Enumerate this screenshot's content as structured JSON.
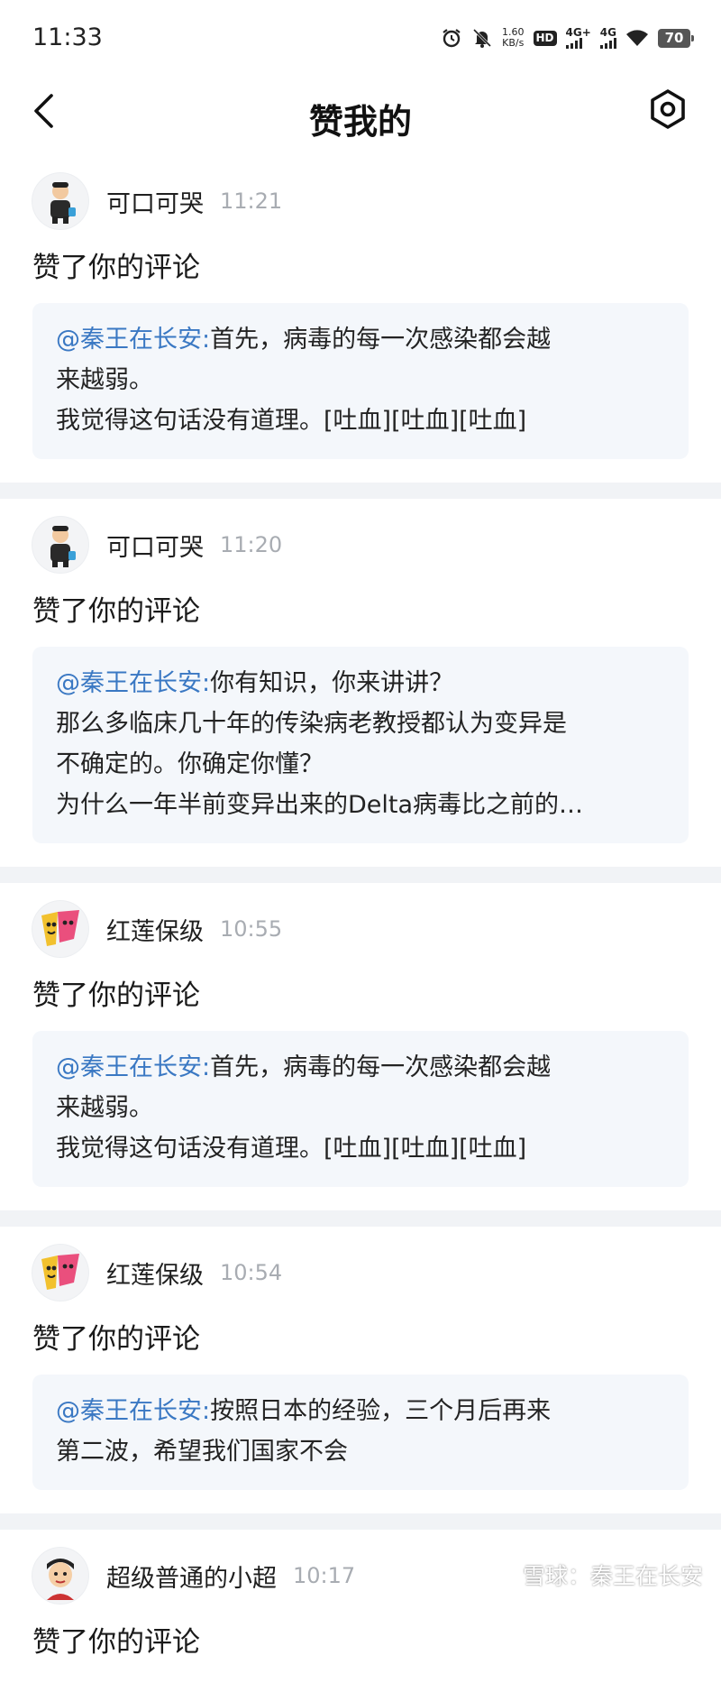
{
  "status_bar": {
    "time": "11:33",
    "net_speed_value": "1.60",
    "net_speed_unit": "KB/s",
    "hd_label": "HD",
    "sim1_label": "4G+",
    "sim2_label": "4G",
    "battery": "70"
  },
  "header": {
    "title": "赞我的"
  },
  "feed": [
    {
      "user": "可口可哭",
      "time": "11:21",
      "action": "赞了你的评论",
      "mention": "@秦王在长安:",
      "lines": [
        "首先，病毒的每一次感染都会越",
        "来越弱。",
        "我觉得这句话没有道理。[吐血][吐血][吐血]"
      ]
    },
    {
      "user": "可口可哭",
      "time": "11:20",
      "action": "赞了你的评论",
      "mention": "@秦王在长安:",
      "lines": [
        "你有知识，你来讲讲？",
        "那么多临床几十年的传染病老教授都认为变异是",
        "不确定的。你确定你懂？",
        "为什么一年半前变异出来的Delta病毒比之前的…"
      ]
    },
    {
      "user": "红莲保级",
      "time": "10:55",
      "action": "赞了你的评论",
      "mention": "@秦王在长安:",
      "lines": [
        "首先，病毒的每一次感染都会越",
        "来越弱。",
        "我觉得这句话没有道理。[吐血][吐血][吐血]"
      ]
    },
    {
      "user": "红莲保级",
      "time": "10:54",
      "action": "赞了你的评论",
      "mention": "@秦王在长安:",
      "lines": [
        "按照日本的经验，三个月后再来",
        "第二波，希望我们国家不会"
      ]
    },
    {
      "user": "超级普通的小超",
      "time": "10:17",
      "action": "赞了你的评论",
      "mention": "",
      "lines": []
    }
  ],
  "watermark": {
    "text": "雪球：秦王在长安"
  },
  "colors": {
    "mention": "#3a78c3",
    "quote_bg": "#f4f7fb",
    "divider": "#f1f3f6",
    "time": "#a8acb2"
  },
  "icons": {
    "back": "chevron-left-icon",
    "settings": "gear-icon"
  }
}
